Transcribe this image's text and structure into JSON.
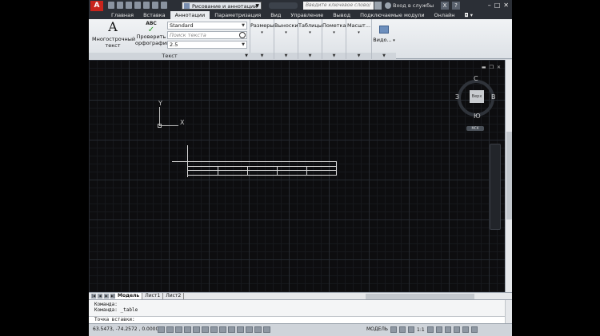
{
  "app": {
    "logo": "A",
    "workspace": "Рисование и аннотации",
    "search_placeholder": "Введите ключевое слово/фразу",
    "login": "Вход в службы",
    "help_glyph": "?",
    "exchange_glyph": "X"
  },
  "ribbon_tabs": [
    {
      "label": "Главная"
    },
    {
      "label": "Вставка"
    },
    {
      "label": "Аннотации"
    },
    {
      "label": "Параметризация"
    },
    {
      "label": "Вид"
    },
    {
      "label": "Управление"
    },
    {
      "label": "Вывод"
    },
    {
      "label": "Подключаемые модули"
    },
    {
      "label": "Онлайн"
    }
  ],
  "text_panel": {
    "multiline_label": "Многострочный текст",
    "multiline_glyph": "A",
    "spell_abc": "ABC",
    "spell_check_mark": "✓",
    "spell_label": "Проверить орфографию",
    "style_value": "Standard",
    "find_placeholder": "Поиск текста",
    "height_value": "2.5",
    "group_title": "Текст"
  },
  "ribbon_groups": [
    {
      "label": "Размеры"
    },
    {
      "label": "Выноски"
    },
    {
      "label": "Таблицы"
    },
    {
      "label": "Пометка"
    },
    {
      "label": "Масшт..."
    },
    {
      "label": "Видо..."
    }
  ],
  "viewcube": {
    "north": "С",
    "south": "Ю",
    "west": "З",
    "east": "В",
    "face": "Верх",
    "wcs": "МСК"
  },
  "ucs": {
    "x_label": "X",
    "y_label": "Y"
  },
  "layout_tabs": [
    {
      "label": "Модель"
    },
    {
      "label": "Лист1"
    },
    {
      "label": "Лист2"
    }
  ],
  "command": {
    "line1": "Команда:",
    "line2": "Команда:  _table",
    "prompt": "Точка вставки:"
  },
  "status": {
    "coords": "63.5473, -74.2572 , 0.0000",
    "model": "МОДЕЛЬ",
    "scale": "1:1"
  }
}
